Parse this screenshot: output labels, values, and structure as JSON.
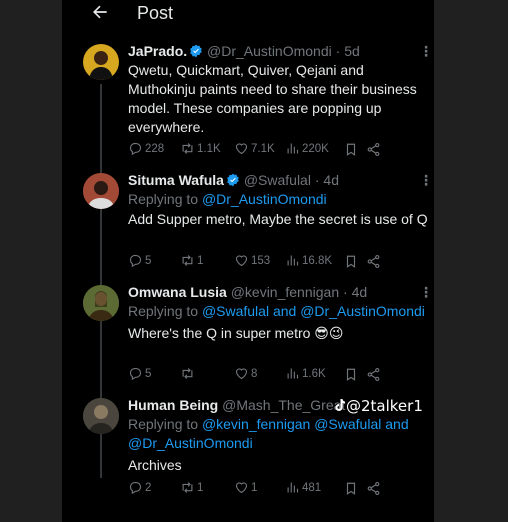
{
  "header": {
    "title": "Post"
  },
  "posts": [
    {
      "name": "JaPrado.",
      "verified": true,
      "handle": "@Dr_AustinOmondi",
      "time": "5d",
      "replying_label": "",
      "replying_to": "",
      "text": "Qwetu, Quickmart, Quiver, Qejani and Muthokinju paints need to share their business model. These companies are popping up everywhere.",
      "replies": "228",
      "reposts": "1.1K",
      "likes": "7.1K",
      "views": "220K"
    },
    {
      "name": "Situma Wafula",
      "verified": true,
      "handle": "@Swafulal",
      "time": "4d",
      "replying_label": "Replying to ",
      "replying_to": "@Dr_AustinOmondi",
      "text": "Add Supper metro, Maybe the secret is use of Q",
      "replies": "5",
      "reposts": "1",
      "likes": "153",
      "views": "16.8K"
    },
    {
      "name": "Omwana Lusia",
      "verified": false,
      "handle": "@kevin_fennigan",
      "time": "4d",
      "replying_label": "Replying to ",
      "replying_to": "@Swafulal and @Dr_AustinOmondi",
      "text": "Where's the Q in super metro 😎😉",
      "replies": "5",
      "reposts": "",
      "likes": "8",
      "views": "1.6K"
    },
    {
      "name": "Human Being",
      "verified": false,
      "handle": "@Mash_The_Great",
      "time": "",
      "replying_label": "Replying to ",
      "replying_to": "@kevin_fennigan @Swafulal and @Dr_AustinOmondi",
      "text": "Archives",
      "replies": "2",
      "reposts": "1",
      "likes": "1",
      "views": "481"
    }
  ],
  "watermark": "@2talker1",
  "colors": {
    "background": "#000000",
    "text": "#e7e9ea",
    "muted": "#71767b",
    "link": "#1d9bf0",
    "verified": "#1d9bf0"
  }
}
